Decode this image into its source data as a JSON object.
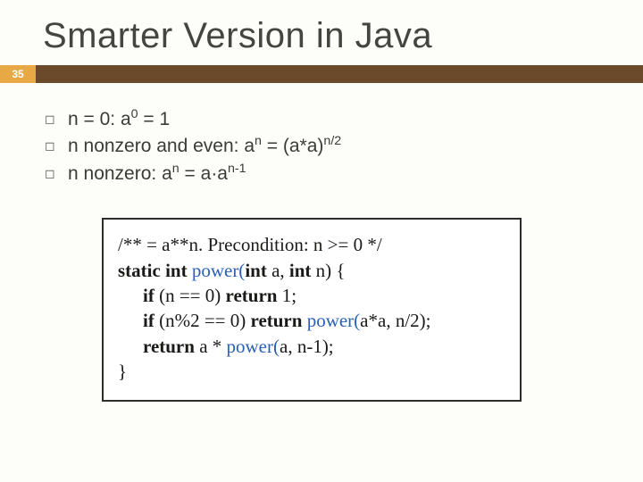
{
  "title": "Smarter Version in Java",
  "page_number": "35",
  "bullets": {
    "b0": {
      "pre": "n = 0:  a",
      "sup": "0",
      "post": " = 1"
    },
    "b1": {
      "pre": "n nonzero and even:  a",
      "sup1": "n",
      "mid": " = (a*a)",
      "sup2": "n/2"
    },
    "b2": {
      "pre": "n nonzero:  a",
      "sup1": "n",
      "mid": " = a·a",
      "sup2": "n-1"
    }
  },
  "code": {
    "l1a": "/** = a**n. Precondition: n >= 0 */",
    "l2_kw1": "static int ",
    "l2_fn": "power(",
    "l2_kw2": "int ",
    "l2_t1": "a, ",
    "l2_kw3": "int ",
    "l2_t2": "n) {",
    "l3_kw1": "if ",
    "l3_t1": "(n == 0) ",
    "l3_kw2": "return ",
    "l3_t2": "1;",
    "l4_kw1": "if ",
    "l4_t1": "(n%2 == 0) ",
    "l4_kw2": "return ",
    "l4_fn": "power(",
    "l4_t2": "a*a, n/2);",
    "l5_kw1": "return ",
    "l5_t1": "a * ",
    "l5_fn": "power(",
    "l5_t2": "a, n-1);",
    "l6": "}"
  }
}
